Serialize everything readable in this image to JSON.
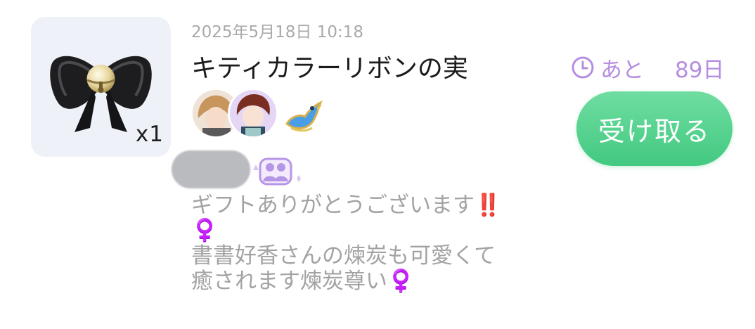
{
  "gift": {
    "quantity": "x1",
    "timestamp": "2025年5月18日 10:18",
    "title": "キティカラーリボンの実",
    "remaining_prefix": "あと",
    "remaining_days": "89日",
    "receive_label": "受け取る",
    "message": "ギフトありがとうございます‼️\n♀️\n書書好香さんの煉炭も可愛くて\n癒されます煉炭尊い♀️"
  },
  "colors": {
    "accent_purple": "#b58ee0",
    "button_green": "#4ccf88",
    "thumb_bg": "#eef1f7",
    "muted_text": "#a3a3a3"
  },
  "icons": {
    "item": "black-bow-with-bell-icon",
    "timer": "clock-icon",
    "sender_badge": "two-people-icon",
    "bird": "blue-bird-badge-icon"
  }
}
